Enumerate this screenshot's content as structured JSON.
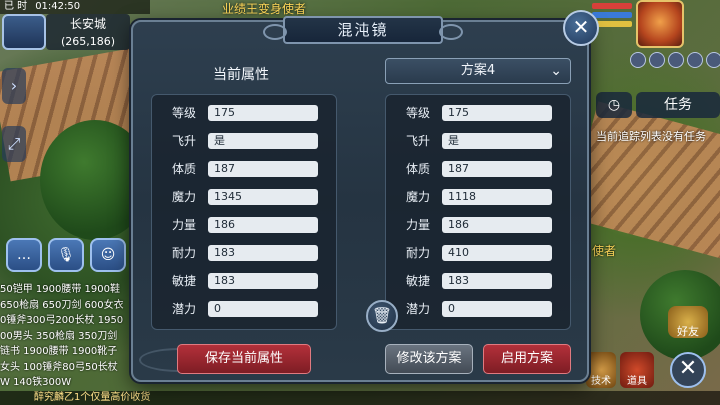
{
  "hud": {
    "status": "已 时",
    "time": "01:42:50",
    "map_name": "长安城",
    "coords": "(265,186)",
    "top_banner": "业绩王变身使者",
    "task_button": "任务",
    "task_text": "当前追踪列表没有任务",
    "npc_label": "使者",
    "friend_label": "好友",
    "item_label": "道具",
    "skill_label": "技术",
    "bottom_text": "醉究麟乙1个仅量高价收货",
    "chat_lines": [
      "50铠甲 1900腰带 1900鞋",
      "650枪扇 650刀剑 600女衣",
      "0锤斧300弓200长杖 1950",
      "00男头 350枪扇 350刀剑",
      "链书 1900腰带 1900靴子",
      "女头 100锤斧80弓50长杖",
      "W 140铁300W"
    ]
  },
  "dialog": {
    "title": "混沌镜",
    "close_icon": "close-icon",
    "current_title": "当前属性",
    "plan_selected": "方案4",
    "current_attrs": [
      {
        "label": "等级",
        "value": "175"
      },
      {
        "label": "飞升",
        "value": "是"
      },
      {
        "label": "体质",
        "value": "187"
      },
      {
        "label": "魔力",
        "value": "1345"
      },
      {
        "label": "力量",
        "value": "186"
      },
      {
        "label": "耐力",
        "value": "183"
      },
      {
        "label": "敏捷",
        "value": "183"
      },
      {
        "label": "潜力",
        "value": "0"
      }
    ],
    "plan_attrs": [
      {
        "label": "等级",
        "value": "175"
      },
      {
        "label": "飞升",
        "value": "是"
      },
      {
        "label": "体质",
        "value": "187"
      },
      {
        "label": "魔力",
        "value": "1118"
      },
      {
        "label": "力量",
        "value": "186"
      },
      {
        "label": "耐力",
        "value": "410"
      },
      {
        "label": "敏捷",
        "value": "183"
      },
      {
        "label": "潜力",
        "value": "0"
      }
    ],
    "save_button": "保存当前属性",
    "modify_button": "修改该方案",
    "apply_button": "启用方案"
  },
  "colors": {
    "accent_red": "#b3303a",
    "panel_bg": "#253442",
    "value_bg": "#e6ebf0"
  }
}
